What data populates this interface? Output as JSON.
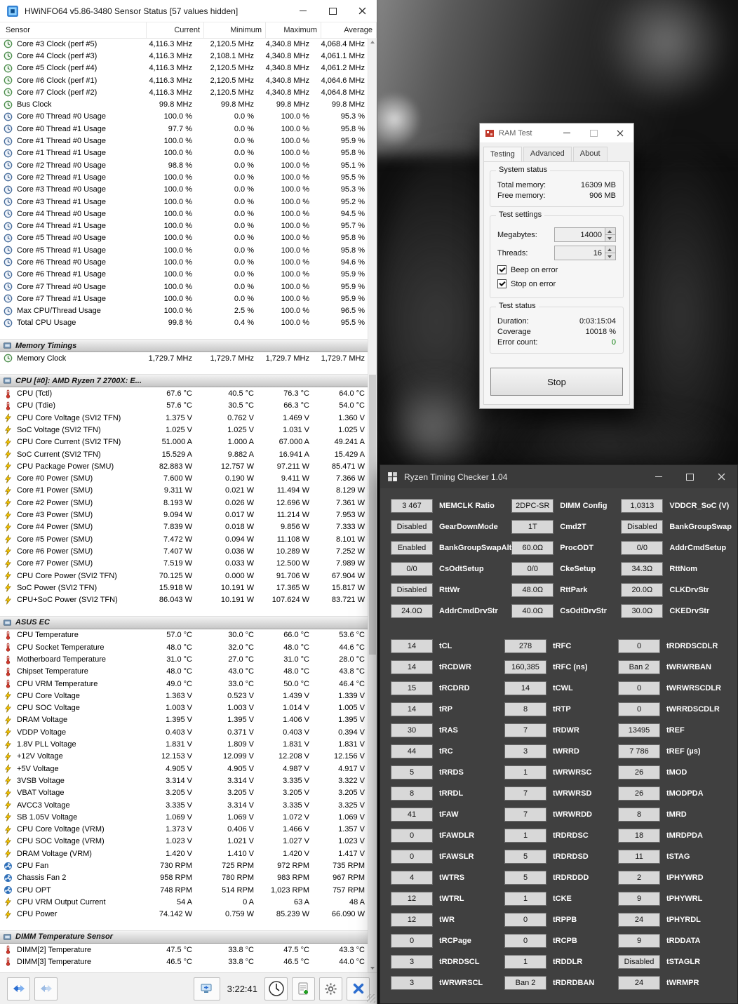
{
  "hwinfo": {
    "title": "HWiNFO64 v5.86-3480 Sensor Status [57 values hidden]",
    "columns": [
      "Sensor",
      "Current",
      "Minimum",
      "Maximum",
      "Average"
    ],
    "time": "3:22:41",
    "rows": [
      {
        "icon": "clock",
        "label": "Core #3 Clock (perf #5)",
        "v": [
          "4,116.3 MHz",
          "2,120.5 MHz",
          "4,340.8 MHz",
          "4,068.4 MHz"
        ]
      },
      {
        "icon": "clock",
        "label": "Core #4 Clock (perf #3)",
        "v": [
          "4,116.3 MHz",
          "2,108.1 MHz",
          "4,340.8 MHz",
          "4,061.1 MHz"
        ]
      },
      {
        "icon": "clock",
        "label": "Core #5 Clock (perf #4)",
        "v": [
          "4,116.3 MHz",
          "2,120.5 MHz",
          "4,340.8 MHz",
          "4,061.2 MHz"
        ]
      },
      {
        "icon": "clock",
        "label": "Core #6 Clock (perf #1)",
        "v": [
          "4,116.3 MHz",
          "2,120.5 MHz",
          "4,340.8 MHz",
          "4,064.6 MHz"
        ]
      },
      {
        "icon": "clock",
        "label": "Core #7 Clock (perf #2)",
        "v": [
          "4,116.3 MHz",
          "2,120.5 MHz",
          "4,340.8 MHz",
          "4,064.8 MHz"
        ]
      },
      {
        "icon": "clock",
        "label": "Bus Clock",
        "v": [
          "99.8 MHz",
          "99.8 MHz",
          "99.8 MHz",
          "99.8 MHz"
        ]
      },
      {
        "icon": "usage",
        "label": "Core #0 Thread #0 Usage",
        "v": [
          "100.0 %",
          "0.0 %",
          "100.0 %",
          "95.3 %"
        ]
      },
      {
        "icon": "usage",
        "label": "Core #0 Thread #1 Usage",
        "v": [
          "97.7 %",
          "0.0 %",
          "100.0 %",
          "95.8 %"
        ]
      },
      {
        "icon": "usage",
        "label": "Core #1 Thread #0 Usage",
        "v": [
          "100.0 %",
          "0.0 %",
          "100.0 %",
          "95.9 %"
        ]
      },
      {
        "icon": "usage",
        "label": "Core #1 Thread #1 Usage",
        "v": [
          "100.0 %",
          "0.0 %",
          "100.0 %",
          "95.8 %"
        ]
      },
      {
        "icon": "usage",
        "label": "Core #2 Thread #0 Usage",
        "v": [
          "98.8 %",
          "0.0 %",
          "100.0 %",
          "95.1 %"
        ]
      },
      {
        "icon": "usage",
        "label": "Core #2 Thread #1 Usage",
        "v": [
          "100.0 %",
          "0.0 %",
          "100.0 %",
          "95.5 %"
        ]
      },
      {
        "icon": "usage",
        "label": "Core #3 Thread #0 Usage",
        "v": [
          "100.0 %",
          "0.0 %",
          "100.0 %",
          "95.3 %"
        ]
      },
      {
        "icon": "usage",
        "label": "Core #3 Thread #1 Usage",
        "v": [
          "100.0 %",
          "0.0 %",
          "100.0 %",
          "95.2 %"
        ]
      },
      {
        "icon": "usage",
        "label": "Core #4 Thread #0 Usage",
        "v": [
          "100.0 %",
          "0.0 %",
          "100.0 %",
          "94.5 %"
        ]
      },
      {
        "icon": "usage",
        "label": "Core #4 Thread #1 Usage",
        "v": [
          "100.0 %",
          "0.0 %",
          "100.0 %",
          "95.7 %"
        ]
      },
      {
        "icon": "usage",
        "label": "Core #5 Thread #0 Usage",
        "v": [
          "100.0 %",
          "0.0 %",
          "100.0 %",
          "95.8 %"
        ]
      },
      {
        "icon": "usage",
        "label": "Core #5 Thread #1 Usage",
        "v": [
          "100.0 %",
          "0.0 %",
          "100.0 %",
          "95.8 %"
        ]
      },
      {
        "icon": "usage",
        "label": "Core #6 Thread #0 Usage",
        "v": [
          "100.0 %",
          "0.0 %",
          "100.0 %",
          "94.6 %"
        ]
      },
      {
        "icon": "usage",
        "label": "Core #6 Thread #1 Usage",
        "v": [
          "100.0 %",
          "0.0 %",
          "100.0 %",
          "95.9 %"
        ]
      },
      {
        "icon": "usage",
        "label": "Core #7 Thread #0 Usage",
        "v": [
          "100.0 %",
          "0.0 %",
          "100.0 %",
          "95.9 %"
        ]
      },
      {
        "icon": "usage",
        "label": "Core #7 Thread #1 Usage",
        "v": [
          "100.0 %",
          "0.0 %",
          "100.0 %",
          "95.9 %"
        ]
      },
      {
        "icon": "usage",
        "label": "Max CPU/Thread Usage",
        "v": [
          "100.0 %",
          "2.5 %",
          "100.0 %",
          "96.5 %"
        ]
      },
      {
        "icon": "usage",
        "label": "Total CPU Usage",
        "v": [
          "99.8 %",
          "0.4 %",
          "100.0 %",
          "95.5 %"
        ]
      },
      {
        "section": "Memory Timings"
      },
      {
        "icon": "clock",
        "label": "Memory Clock",
        "v": [
          "1,729.7 MHz",
          "1,729.7 MHz",
          "1,729.7 MHz",
          "1,729.7 MHz"
        ]
      },
      {
        "section": "CPU [#0]: AMD Ryzen 7 2700X: E..."
      },
      {
        "icon": "temp",
        "label": "CPU (Tctl)",
        "v": [
          "67.6 °C",
          "40.5 °C",
          "76.3 °C",
          "64.0 °C"
        ]
      },
      {
        "icon": "temp",
        "label": "CPU (Tdie)",
        "v": [
          "57.6 °C",
          "30.5 °C",
          "66.3 °C",
          "54.0 °C"
        ]
      },
      {
        "icon": "bolt",
        "label": "CPU Core Voltage (SVI2 TFN)",
        "v": [
          "1.375 V",
          "0.762 V",
          "1.469 V",
          "1.360 V"
        ]
      },
      {
        "icon": "bolt",
        "label": "SoC Voltage (SVI2 TFN)",
        "v": [
          "1.025 V",
          "1.025 V",
          "1.031 V",
          "1.025 V"
        ]
      },
      {
        "icon": "bolt",
        "label": "CPU Core Current (SVI2 TFN)",
        "v": [
          "51.000 A",
          "1.000 A",
          "67.000 A",
          "49.241 A"
        ]
      },
      {
        "icon": "bolt",
        "label": "SoC Current (SVI2 TFN)",
        "v": [
          "15.529 A",
          "9.882 A",
          "16.941 A",
          "15.429 A"
        ]
      },
      {
        "icon": "bolt",
        "label": "CPU Package Power (SMU)",
        "v": [
          "82.883 W",
          "12.757 W",
          "97.211 W",
          "85.471 W"
        ]
      },
      {
        "icon": "bolt",
        "label": "Core #0 Power (SMU)",
        "v": [
          "7.600 W",
          "0.190 W",
          "9.411 W",
          "7.366 W"
        ]
      },
      {
        "icon": "bolt",
        "label": "Core #1 Power (SMU)",
        "v": [
          "9.311 W",
          "0.021 W",
          "11.494 W",
          "8.129 W"
        ]
      },
      {
        "icon": "bolt",
        "label": "Core #2 Power (SMU)",
        "v": [
          "8.193 W",
          "0.026 W",
          "12.696 W",
          "7.361 W"
        ]
      },
      {
        "icon": "bolt",
        "label": "Core #3 Power (SMU)",
        "v": [
          "9.094 W",
          "0.017 W",
          "11.214 W",
          "7.953 W"
        ]
      },
      {
        "icon": "bolt",
        "label": "Core #4 Power (SMU)",
        "v": [
          "7.839 W",
          "0.018 W",
          "9.856 W",
          "7.333 W"
        ]
      },
      {
        "icon": "bolt",
        "label": "Core #5 Power (SMU)",
        "v": [
          "7.472 W",
          "0.094 W",
          "11.108 W",
          "8.101 W"
        ]
      },
      {
        "icon": "bolt",
        "label": "Core #6 Power (SMU)",
        "v": [
          "7.407 W",
          "0.036 W",
          "10.289 W",
          "7.252 W"
        ]
      },
      {
        "icon": "bolt",
        "label": "Core #7 Power (SMU)",
        "v": [
          "7.519 W",
          "0.033 W",
          "12.500 W",
          "7.989 W"
        ]
      },
      {
        "icon": "bolt",
        "label": "CPU Core Power (SVI2 TFN)",
        "v": [
          "70.125 W",
          "0.000 W",
          "91.706 W",
          "67.904 W"
        ]
      },
      {
        "icon": "bolt",
        "label": "SoC Power (SVI2 TFN)",
        "v": [
          "15.918 W",
          "10.191 W",
          "17.365 W",
          "15.817 W"
        ]
      },
      {
        "icon": "bolt",
        "label": "CPU+SoC Power (SVI2 TFN)",
        "v": [
          "86.043 W",
          "10.191 W",
          "107.624 W",
          "83.721 W"
        ]
      },
      {
        "section": "ASUS EC"
      },
      {
        "icon": "temp",
        "label": "CPU Temperature",
        "v": [
          "57.0 °C",
          "30.0 °C",
          "66.0 °C",
          "53.6 °C"
        ]
      },
      {
        "icon": "temp",
        "label": "CPU Socket Temperature",
        "v": [
          "48.0 °C",
          "32.0 °C",
          "48.0 °C",
          "44.6 °C"
        ]
      },
      {
        "icon": "temp",
        "label": "Motherboard Temperature",
        "v": [
          "31.0 °C",
          "27.0 °C",
          "31.0 °C",
          "28.0 °C"
        ]
      },
      {
        "icon": "temp",
        "label": "Chipset Temperature",
        "v": [
          "48.0 °C",
          "43.0 °C",
          "48.0 °C",
          "43.8 °C"
        ]
      },
      {
        "icon": "temp",
        "label": "CPU VRM Temperature",
        "v": [
          "49.0 °C",
          "33.0 °C",
          "50.0 °C",
          "46.4 °C"
        ]
      },
      {
        "icon": "bolt",
        "label": "CPU Core Voltage",
        "v": [
          "1.363 V",
          "0.523 V",
          "1.439 V",
          "1.339 V"
        ]
      },
      {
        "icon": "bolt",
        "label": "CPU SOC Voltage",
        "v": [
          "1.003 V",
          "1.003 V",
          "1.014 V",
          "1.005 V"
        ]
      },
      {
        "icon": "bolt",
        "label": "DRAM Voltage",
        "v": [
          "1.395 V",
          "1.395 V",
          "1.406 V",
          "1.395 V"
        ]
      },
      {
        "icon": "bolt",
        "label": "VDDP Voltage",
        "v": [
          "0.403 V",
          "0.371 V",
          "0.403 V",
          "0.394 V"
        ]
      },
      {
        "icon": "bolt",
        "label": "1.8V PLL Voltage",
        "v": [
          "1.831 V",
          "1.809 V",
          "1.831 V",
          "1.831 V"
        ]
      },
      {
        "icon": "bolt",
        "label": "+12V Voltage",
        "v": [
          "12.153 V",
          "12.099 V",
          "12.208 V",
          "12.156 V"
        ]
      },
      {
        "icon": "bolt",
        "label": "+5V Voltage",
        "v": [
          "4.905 V",
          "4.905 V",
          "4.987 V",
          "4.917 V"
        ]
      },
      {
        "icon": "bolt",
        "label": "3VSB Voltage",
        "v": [
          "3.314 V",
          "3.314 V",
          "3.335 V",
          "3.322 V"
        ]
      },
      {
        "icon": "bolt",
        "label": "VBAT Voltage",
        "v": [
          "3.205 V",
          "3.205 V",
          "3.205 V",
          "3.205 V"
        ]
      },
      {
        "icon": "bolt",
        "label": "AVCC3 Voltage",
        "v": [
          "3.335 V",
          "3.314 V",
          "3.335 V",
          "3.325 V"
        ]
      },
      {
        "icon": "bolt",
        "label": "SB 1.05V Voltage",
        "v": [
          "1.069 V",
          "1.069 V",
          "1.072 V",
          "1.069 V"
        ]
      },
      {
        "icon": "bolt",
        "label": "CPU Core Voltage (VRM)",
        "v": [
          "1.373 V",
          "0.406 V",
          "1.466 V",
          "1.357 V"
        ]
      },
      {
        "icon": "bolt",
        "label": "CPU SOC Voltage (VRM)",
        "v": [
          "1.023 V",
          "1.021 V",
          "1.027 V",
          "1.023 V"
        ]
      },
      {
        "icon": "bolt",
        "label": "DRAM Voltage (VRM)",
        "v": [
          "1.420 V",
          "1.410 V",
          "1.420 V",
          "1.417 V"
        ]
      },
      {
        "icon": "fan",
        "label": "CPU Fan",
        "v": [
          "730 RPM",
          "725 RPM",
          "972 RPM",
          "735 RPM"
        ]
      },
      {
        "icon": "fan",
        "label": "Chassis Fan 2",
        "v": [
          "958 RPM",
          "780 RPM",
          "983 RPM",
          "967 RPM"
        ]
      },
      {
        "icon": "fan",
        "label": "CPU OPT",
        "v": [
          "748 RPM",
          "514 RPM",
          "1,023 RPM",
          "757 RPM"
        ]
      },
      {
        "icon": "bolt",
        "label": "CPU VRM Output Current",
        "v": [
          "54 A",
          "0 A",
          "63 A",
          "48 A"
        ]
      },
      {
        "icon": "bolt",
        "label": "CPU Power",
        "v": [
          "74.142 W",
          "0.759 W",
          "85.239 W",
          "66.090 W"
        ]
      },
      {
        "section": "DIMM Temperature Sensor"
      },
      {
        "icon": "temp",
        "label": "DIMM[2] Temperature",
        "v": [
          "47.5 °C",
          "33.8 °C",
          "47.5 °C",
          "43.3 °C"
        ]
      },
      {
        "icon": "temp",
        "label": "DIMM[3] Temperature",
        "v": [
          "46.5 °C",
          "33.8 °C",
          "46.5 °C",
          "44.0 °C"
        ]
      }
    ]
  },
  "ramtest": {
    "title": "RAM Test",
    "tabs": [
      "Testing",
      "Advanced",
      "About"
    ],
    "system_status": {
      "group_label": "System status",
      "total_label": "Total memory:",
      "total_value": "16309 MB",
      "free_label": "Free memory:",
      "free_value": "906 MB"
    },
    "test_settings": {
      "group_label": "Test settings",
      "megabytes_label": "Megabytes:",
      "megabytes_value": "14000",
      "threads_label": "Threads:",
      "threads_value": "16",
      "beep_label": "Beep on error",
      "stop_label": "Stop on error"
    },
    "test_status": {
      "group_label": "Test status",
      "duration_label": "Duration:",
      "duration_value": "0:03:15:04",
      "coverage_label": "Coverage",
      "coverage_value": "10018 %",
      "errors_label": "Error count:",
      "errors_value": "0",
      "error_color": "#0a7d0a"
    },
    "stop_button": "Stop"
  },
  "rtc": {
    "title": "Ryzen Timing Checker 1.04",
    "config_cells": [
      {
        "v": "3 467",
        "l": "MEMCLK Ratio"
      },
      {
        "v": "2DPC-SR",
        "l": "DIMM Config"
      },
      {
        "v": "1,0313",
        "l": "VDDCR_SoC (V)"
      },
      {
        "v": "Disabled",
        "l": "GearDownMode"
      },
      {
        "v": "1T",
        "l": "Cmd2T"
      },
      {
        "v": "Disabled",
        "l": "BankGroupSwap"
      },
      {
        "v": "Enabled",
        "l": "BankGroupSwapAlt"
      },
      {
        "v": "60.0Ω",
        "l": "ProcODT"
      },
      {
        "v": "0/0",
        "l": "AddrCmdSetup"
      },
      {
        "v": "0/0",
        "l": "CsOdtSetup"
      },
      {
        "v": "0/0",
        "l": "CkeSetup"
      },
      {
        "v": "34.3Ω",
        "l": "RttNom"
      },
      {
        "v": "Disabled",
        "l": "RttWr"
      },
      {
        "v": "48.0Ω",
        "l": "RttPark"
      },
      {
        "v": "20.0Ω",
        "l": "CLKDrvStr"
      },
      {
        "v": "24.0Ω",
        "l": "AddrCmdDrvStr"
      },
      {
        "v": "40.0Ω",
        "l": "CsOdtDrvStr"
      },
      {
        "v": "30.0Ω",
        "l": "CKEDrvStr"
      }
    ],
    "timing_cells": [
      {
        "v": "14",
        "l": "tCL"
      },
      {
        "v": "278",
        "l": "tRFC"
      },
      {
        "v": "0",
        "l": "tRDRDSCDLR"
      },
      {
        "v": "14",
        "l": "tRCDWR"
      },
      {
        "v": "160,385",
        "l": "tRFC (ns)"
      },
      {
        "v": "Ban 2",
        "l": "tWRWRBAN"
      },
      {
        "v": "15",
        "l": "tRCDRD"
      },
      {
        "v": "14",
        "l": "tCWL"
      },
      {
        "v": "0",
        "l": "tWRWRSCDLR"
      },
      {
        "v": "14",
        "l": "tRP"
      },
      {
        "v": "8",
        "l": "tRTP"
      },
      {
        "v": "0",
        "l": "tWRRDSCDLR"
      },
      {
        "v": "30",
        "l": "tRAS"
      },
      {
        "v": "7",
        "l": "tRDWR"
      },
      {
        "v": "13495",
        "l": "tREF"
      },
      {
        "v": "44",
        "l": "tRC"
      },
      {
        "v": "3",
        "l": "tWRRD"
      },
      {
        "v": "7 786",
        "l": "tREF (µs)"
      },
      {
        "v": "5",
        "l": "tRRDS"
      },
      {
        "v": "1",
        "l": "tWRWRSC"
      },
      {
        "v": "26",
        "l": "tMOD"
      },
      {
        "v": "8",
        "l": "tRRDL"
      },
      {
        "v": "7",
        "l": "tWRWRSD"
      },
      {
        "v": "26",
        "l": "tMODPDA"
      },
      {
        "v": "41",
        "l": "tFAW"
      },
      {
        "v": "7",
        "l": "tWRWRDD"
      },
      {
        "v": "8",
        "l": "tMRD"
      },
      {
        "v": "0",
        "l": "tFAWDLR"
      },
      {
        "v": "1",
        "l": "tRDRDSC"
      },
      {
        "v": "18",
        "l": "tMRDPDA"
      },
      {
        "v": "0",
        "l": "tFAWSLR"
      },
      {
        "v": "5",
        "l": "tRDRDSD"
      },
      {
        "v": "11",
        "l": "tSTAG"
      },
      {
        "v": "4",
        "l": "tWTRS"
      },
      {
        "v": "5",
        "l": "tRDRDDD"
      },
      {
        "v": "2",
        "l": "tPHYWRD"
      },
      {
        "v": "12",
        "l": "tWTRL"
      },
      {
        "v": "1",
        "l": "tCKE"
      },
      {
        "v": "9",
        "l": "tPHYWRL"
      },
      {
        "v": "12",
        "l": "tWR"
      },
      {
        "v": "0",
        "l": "tRPPB"
      },
      {
        "v": "24",
        "l": "tPHYRDL"
      },
      {
        "v": "0",
        "l": "tRCPage"
      },
      {
        "v": "0",
        "l": "tRCPB"
      },
      {
        "v": "9",
        "l": "tRDDATA"
      },
      {
        "v": "3",
        "l": "tRDRDSCL"
      },
      {
        "v": "1",
        "l": "tRDDLR"
      },
      {
        "v": "Disabled",
        "l": "tSTAGLR"
      },
      {
        "v": "3",
        "l": "tWRWRSCL"
      },
      {
        "v": "Ban 2",
        "l": "tRDRDBAN"
      },
      {
        "v": "24",
        "l": "tWRMPR"
      }
    ]
  }
}
